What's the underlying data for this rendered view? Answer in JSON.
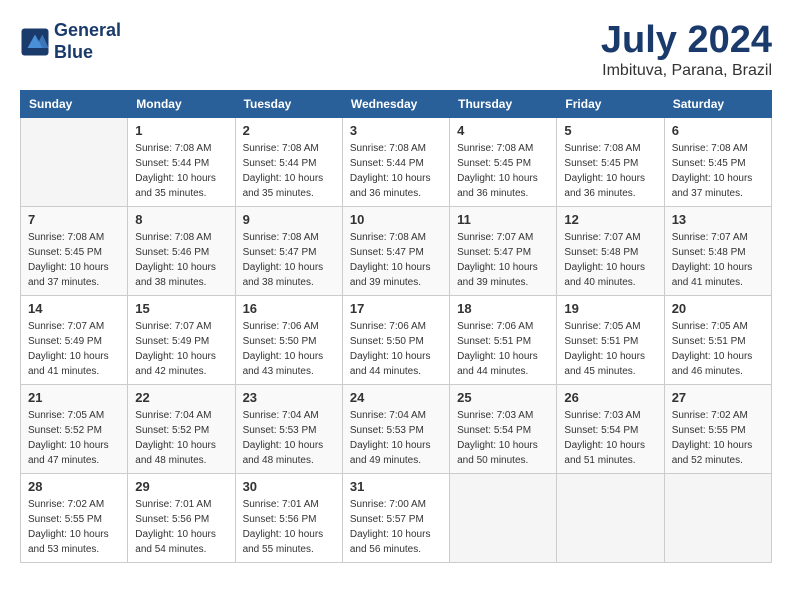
{
  "header": {
    "logo_line1": "General",
    "logo_line2": "Blue",
    "month_year": "July 2024",
    "location": "Imbituva, Parana, Brazil"
  },
  "days_of_week": [
    "Sunday",
    "Monday",
    "Tuesday",
    "Wednesday",
    "Thursday",
    "Friday",
    "Saturday"
  ],
  "weeks": [
    [
      {
        "day": "",
        "info": ""
      },
      {
        "day": "1",
        "info": "Sunrise: 7:08 AM\nSunset: 5:44 PM\nDaylight: 10 hours\nand 35 minutes."
      },
      {
        "day": "2",
        "info": "Sunrise: 7:08 AM\nSunset: 5:44 PM\nDaylight: 10 hours\nand 35 minutes."
      },
      {
        "day": "3",
        "info": "Sunrise: 7:08 AM\nSunset: 5:44 PM\nDaylight: 10 hours\nand 36 minutes."
      },
      {
        "day": "4",
        "info": "Sunrise: 7:08 AM\nSunset: 5:45 PM\nDaylight: 10 hours\nand 36 minutes."
      },
      {
        "day": "5",
        "info": "Sunrise: 7:08 AM\nSunset: 5:45 PM\nDaylight: 10 hours\nand 36 minutes."
      },
      {
        "day": "6",
        "info": "Sunrise: 7:08 AM\nSunset: 5:45 PM\nDaylight: 10 hours\nand 37 minutes."
      }
    ],
    [
      {
        "day": "7",
        "info": "Sunrise: 7:08 AM\nSunset: 5:45 PM\nDaylight: 10 hours\nand 37 minutes."
      },
      {
        "day": "8",
        "info": "Sunrise: 7:08 AM\nSunset: 5:46 PM\nDaylight: 10 hours\nand 38 minutes."
      },
      {
        "day": "9",
        "info": "Sunrise: 7:08 AM\nSunset: 5:47 PM\nDaylight: 10 hours\nand 38 minutes."
      },
      {
        "day": "10",
        "info": "Sunrise: 7:08 AM\nSunset: 5:47 PM\nDaylight: 10 hours\nand 39 minutes."
      },
      {
        "day": "11",
        "info": "Sunrise: 7:07 AM\nSunset: 5:47 PM\nDaylight: 10 hours\nand 39 minutes."
      },
      {
        "day": "12",
        "info": "Sunrise: 7:07 AM\nSunset: 5:48 PM\nDaylight: 10 hours\nand 40 minutes."
      },
      {
        "day": "13",
        "info": "Sunrise: 7:07 AM\nSunset: 5:48 PM\nDaylight: 10 hours\nand 41 minutes."
      }
    ],
    [
      {
        "day": "14",
        "info": "Sunrise: 7:07 AM\nSunset: 5:49 PM\nDaylight: 10 hours\nand 41 minutes."
      },
      {
        "day": "15",
        "info": "Sunrise: 7:07 AM\nSunset: 5:49 PM\nDaylight: 10 hours\nand 42 minutes."
      },
      {
        "day": "16",
        "info": "Sunrise: 7:06 AM\nSunset: 5:50 PM\nDaylight: 10 hours\nand 43 minutes."
      },
      {
        "day": "17",
        "info": "Sunrise: 7:06 AM\nSunset: 5:50 PM\nDaylight: 10 hours\nand 44 minutes."
      },
      {
        "day": "18",
        "info": "Sunrise: 7:06 AM\nSunset: 5:51 PM\nDaylight: 10 hours\nand 44 minutes."
      },
      {
        "day": "19",
        "info": "Sunrise: 7:05 AM\nSunset: 5:51 PM\nDaylight: 10 hours\nand 45 minutes."
      },
      {
        "day": "20",
        "info": "Sunrise: 7:05 AM\nSunset: 5:51 PM\nDaylight: 10 hours\nand 46 minutes."
      }
    ],
    [
      {
        "day": "21",
        "info": "Sunrise: 7:05 AM\nSunset: 5:52 PM\nDaylight: 10 hours\nand 47 minutes."
      },
      {
        "day": "22",
        "info": "Sunrise: 7:04 AM\nSunset: 5:52 PM\nDaylight: 10 hours\nand 48 minutes."
      },
      {
        "day": "23",
        "info": "Sunrise: 7:04 AM\nSunset: 5:53 PM\nDaylight: 10 hours\nand 48 minutes."
      },
      {
        "day": "24",
        "info": "Sunrise: 7:04 AM\nSunset: 5:53 PM\nDaylight: 10 hours\nand 49 minutes."
      },
      {
        "day": "25",
        "info": "Sunrise: 7:03 AM\nSunset: 5:54 PM\nDaylight: 10 hours\nand 50 minutes."
      },
      {
        "day": "26",
        "info": "Sunrise: 7:03 AM\nSunset: 5:54 PM\nDaylight: 10 hours\nand 51 minutes."
      },
      {
        "day": "27",
        "info": "Sunrise: 7:02 AM\nSunset: 5:55 PM\nDaylight: 10 hours\nand 52 minutes."
      }
    ],
    [
      {
        "day": "28",
        "info": "Sunrise: 7:02 AM\nSunset: 5:55 PM\nDaylight: 10 hours\nand 53 minutes."
      },
      {
        "day": "29",
        "info": "Sunrise: 7:01 AM\nSunset: 5:56 PM\nDaylight: 10 hours\nand 54 minutes."
      },
      {
        "day": "30",
        "info": "Sunrise: 7:01 AM\nSunset: 5:56 PM\nDaylight: 10 hours\nand 55 minutes."
      },
      {
        "day": "31",
        "info": "Sunrise: 7:00 AM\nSunset: 5:57 PM\nDaylight: 10 hours\nand 56 minutes."
      },
      {
        "day": "",
        "info": ""
      },
      {
        "day": "",
        "info": ""
      },
      {
        "day": "",
        "info": ""
      }
    ]
  ]
}
